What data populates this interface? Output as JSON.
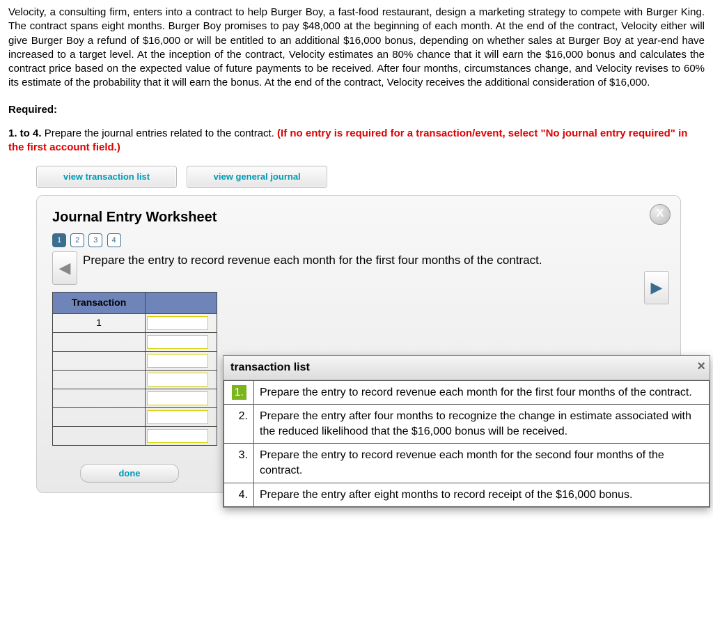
{
  "problem": "Velocity, a consulting firm, enters into a contract to help Burger Boy, a fast-food restaurant, design a marketing strategy to compete with Burger King. The contract spans eight months. Burger Boy promises to pay $48,000 at the beginning of each month. At the end of the contract, Velocity either will give Burger Boy a refund of $16,000 or will be entitled to an additional $16,000 bonus, depending on whether sales at Burger Boy at year-end have increased to a target level. At the inception of the contract, Velocity estimates an 80% chance that it will earn the $16,000 bonus and calculates the contract price based on the expected value of future payments to be received. After four months, circumstances change, and Velocity revises to 60% its estimate of the probability that it will earn the bonus. At the end of the contract, Velocity receives the additional consideration of $16,000.",
  "required_label": "Required:",
  "requirement": {
    "prefix": "1. to 4.",
    "black": "Prepare the journal entries related to the contract. ",
    "red": "(If no entry is required for a transaction/event, select \"No journal entry required\" in the first account field.)"
  },
  "buttons": {
    "view_tx": "view transaction list",
    "view_gj": "view general journal",
    "done": "done"
  },
  "worksheet": {
    "title": "Journal Entry Worksheet",
    "steps": [
      "1",
      "2",
      "3",
      "4"
    ],
    "instruction": "Prepare the entry to record revenue each month for the first four months of the contract.",
    "tx_header": "Transaction",
    "tx_number": "1"
  },
  "popup": {
    "title": "transaction list",
    "items": [
      "Prepare the entry to record revenue each month for the first four months of the contract.",
      "Prepare the entry after four months to recognize the change in estimate associated with the reduced likelihood that the $16,000 bonus will be received.",
      "Prepare the entry to record revenue each month for the second four months of the contract.",
      "Prepare the entry after eight months to record receipt of the $16,000 bonus."
    ],
    "nums": [
      "1.",
      "2.",
      "3.",
      "4."
    ]
  }
}
